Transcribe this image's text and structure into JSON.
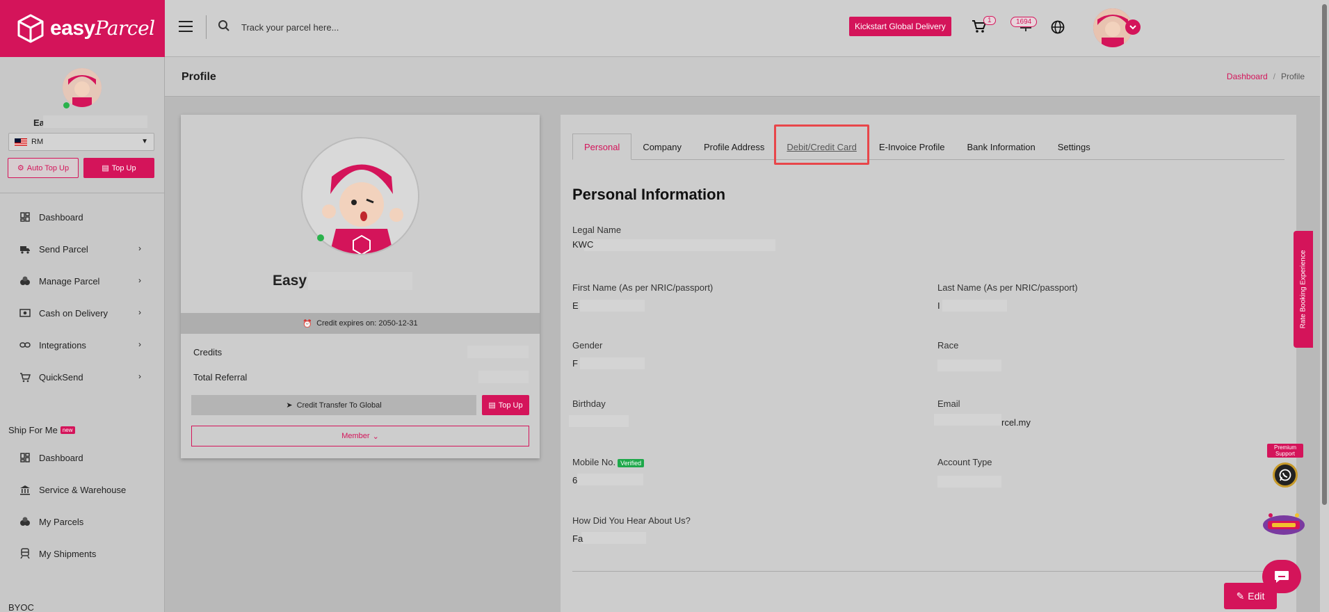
{
  "brand": {
    "logo_main": "easy",
    "logo_script": "Parcel",
    "accent": "#d4145a"
  },
  "topbar": {
    "search_placeholder": "Track your parcel here...",
    "kickstart_label": "Kickstart Global Delivery",
    "cart_count": "1",
    "points": "1694",
    "icons": [
      "menu-icon",
      "search-icon",
      "cart-icon",
      "points-icon",
      "globe-icon",
      "avatar",
      "chevron-down-icon"
    ]
  },
  "sidebar": {
    "user_name": "Ea",
    "currency": "RM",
    "auto_topup_label": "Auto Top Up",
    "topup_label": "Top Up",
    "nav": [
      {
        "label": "Dashboard",
        "icon": "dashboard-icon",
        "has_children": false
      },
      {
        "label": "Send Parcel",
        "icon": "truck-icon",
        "has_children": true
      },
      {
        "label": "Manage Parcel",
        "icon": "boxes-icon",
        "has_children": true
      },
      {
        "label": "Cash on Delivery",
        "icon": "cash-icon",
        "has_children": true
      },
      {
        "label": "Integrations",
        "icon": "link-icon",
        "has_children": true
      },
      {
        "label": "QuickSend",
        "icon": "cart-icon",
        "has_children": true
      }
    ],
    "ship_for_me": {
      "title": "Ship For Me",
      "badge": "new"
    },
    "ship_nav": [
      {
        "label": "Dashboard",
        "icon": "dashboard-icon"
      },
      {
        "label": "Service & Warehouse",
        "icon": "bank-icon"
      },
      {
        "label": "My Parcels",
        "icon": "boxes-icon"
      },
      {
        "label": "My Shipments",
        "icon": "shipment-icon"
      }
    ],
    "byoc": "BYOC"
  },
  "header": {
    "title": "Profile",
    "breadcrumb": {
      "home": "Dashboard",
      "separator": "/",
      "current": "Profile"
    }
  },
  "profile_card": {
    "name": "Easy",
    "credit_expiry": "Credit expires on: 2050-12-31",
    "credits_label": "Credits",
    "referral_label": "Total Referral",
    "transfer_label": "Credit Transfer To Global",
    "topup_label": "Top Up",
    "member_label": "Member"
  },
  "tabs": [
    {
      "label": "Personal",
      "active": true
    },
    {
      "label": "Company",
      "active": false
    },
    {
      "label": "Profile Address",
      "active": false
    },
    {
      "label": "Debit/Credit Card",
      "active": false,
      "highlighted": true
    },
    {
      "label": "E-Invoice Profile",
      "active": false
    },
    {
      "label": "Bank Information",
      "active": false
    },
    {
      "label": "Settings",
      "active": false
    }
  ],
  "personal": {
    "section_title": "Personal Information",
    "legal_name_label": "Legal Name",
    "legal_name_value": "KWC",
    "first_name_label": "First Name (As per NRIC/passport)",
    "first_name_value": "E",
    "last_name_label": "Last Name (As per NRIC/passport)",
    "last_name_value": "I",
    "gender_label": "Gender",
    "gender_value": "F",
    "race_label": "Race",
    "race_value": "",
    "birthday_label": "Birthday",
    "birthday_value": "",
    "email_label": "Email",
    "email_value": "rcel.my",
    "mobile_label": "Mobile No.",
    "mobile_verified": "Verified",
    "mobile_value": "6",
    "account_type_label": "Account Type",
    "account_type_value": "",
    "hear_label": "How Did You Hear About Us?",
    "hear_value": "Fa",
    "edit_label": "Edit"
  },
  "widgets": {
    "rate_tab": "Rate Booking Experience",
    "premium_label": "Premium Support"
  }
}
